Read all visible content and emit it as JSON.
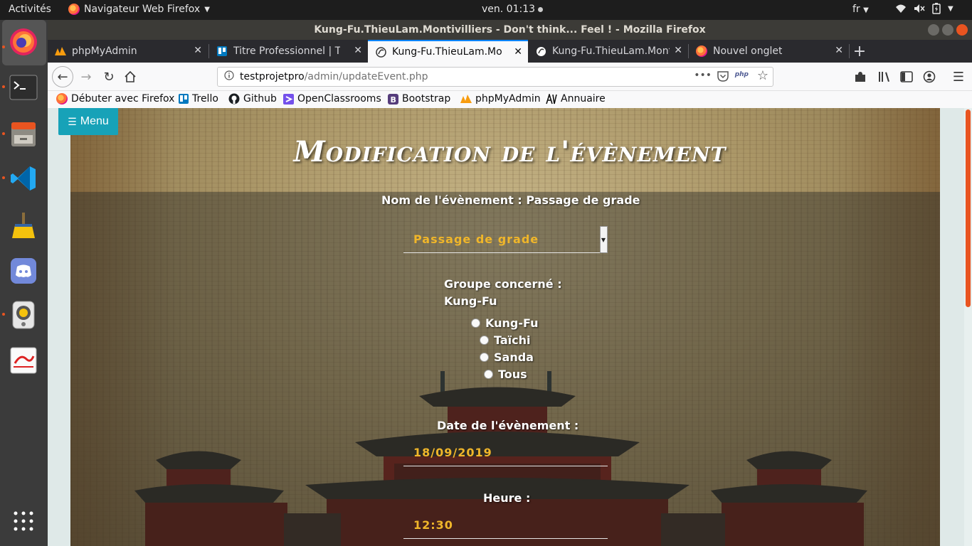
{
  "system": {
    "activities": "Activités",
    "app_name": "Navigateur Web Firefox",
    "clock": "ven. 01:13",
    "language": "fr"
  },
  "window": {
    "title": "Kung-Fu.ThieuLam.Montivilliers - Don't think... Feel ! - Mozilla Firefox"
  },
  "tabs": [
    {
      "label": "phpMyAdmin",
      "icon": "phpmyadmin-icon"
    },
    {
      "label": "Titre Professionnel | Trello",
      "icon": "trello-icon"
    },
    {
      "label": "Kung-Fu.ThieuLam.Montivilliers",
      "icon": "site-icon",
      "selected": true
    },
    {
      "label": "Kung-Fu.ThieuLam.Montivilliers",
      "icon": "site-icon"
    },
    {
      "label": "Nouvel onglet",
      "icon": "firefox-icon"
    }
  ],
  "url": {
    "host": "testprojetpro",
    "path": "/admin/updateEvent.php"
  },
  "bookmarks": [
    {
      "label": "Débuter avec Firefox",
      "icon": "firefox-icon"
    },
    {
      "label": "Trello",
      "icon": "trello-icon"
    },
    {
      "label": "Github",
      "icon": "github-icon"
    },
    {
      "label": "OpenClassrooms",
      "icon": "openclassrooms-icon"
    },
    {
      "label": "Bootstrap",
      "icon": "bootstrap-icon"
    },
    {
      "label": "phpMyAdmin",
      "icon": "phpmyadmin-icon"
    },
    {
      "label": "Annuaire",
      "icon": "annuaire-icon"
    }
  ],
  "page": {
    "menu_label": "Menu",
    "title": "Modification de l'évènement",
    "event_name_label": "Nom de l'évènement : Passage de grade",
    "event_select_value": "Passage de grade",
    "group_label": "Groupe concerné :",
    "group_current": "Kung-Fu",
    "group_options": [
      "Kung-Fu",
      "Taïchi",
      "Sanda",
      "Tous"
    ],
    "date_label": "Date de l'évènement :",
    "date_value": "18/09/2019",
    "time_label": "Heure :",
    "time_value": "12:30"
  },
  "colors": {
    "accent": "#e95420",
    "menu_button": "#17a2b8",
    "field_text": "#f0b62a"
  }
}
